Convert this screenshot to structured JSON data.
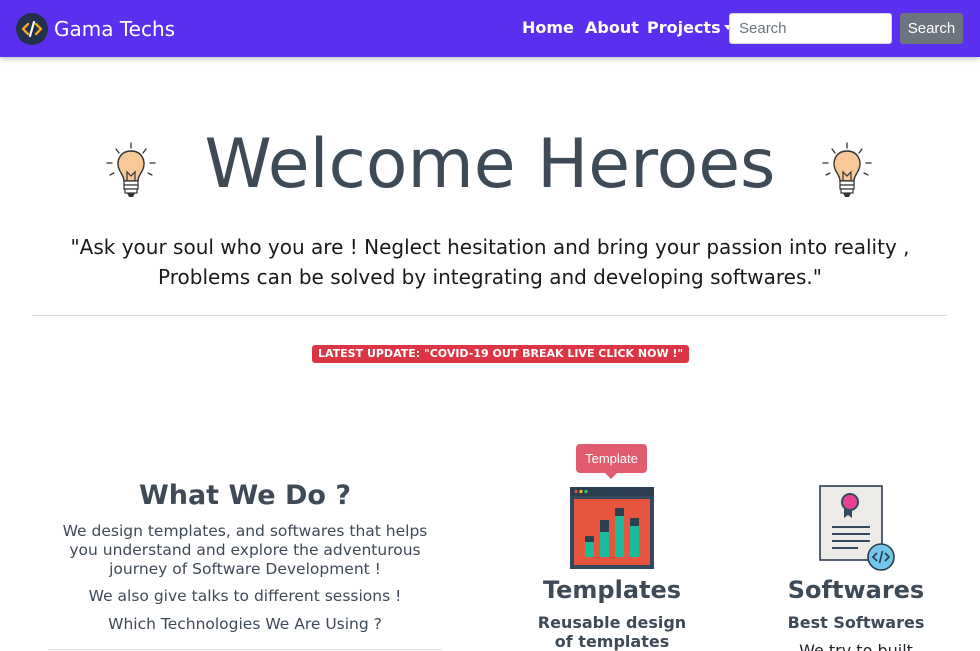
{
  "navbar": {
    "brand": "Gama Techs",
    "brand_icon": "code-icon",
    "links": {
      "home": "Home",
      "about": "About",
      "projects": "Projects"
    },
    "search": {
      "placeholder": "Search",
      "button": "Search"
    },
    "colors": {
      "background": "#5b2ff0",
      "button": "#6c757d"
    }
  },
  "hero": {
    "title": "Welcome Heroes",
    "quote": "\"Ask your soul who you are ! Neglect hesitation and bring your passion into reality , Problems can be solved by integrating and developing softwares.\"",
    "badge": "LATEST UPDATE: \"COVID-19 OUT BREAK LIVE CLICK NOW !\"",
    "badge_color": "#dc3545",
    "icons": [
      "light-bulb-icon",
      "light-bulb-icon"
    ]
  },
  "what_we_do": {
    "title": "What We Do ?",
    "paragraph1": "We design templates, and softwares that helps you understand and explore the adventurous journey of Software Development !",
    "paragraph2": "We also give talks to different sessions !",
    "paragraph3": "Which Technologies We Are Using ?"
  },
  "cards": {
    "templates": {
      "tooltip": "Template",
      "title": "Templates",
      "subtitle": "Reusable design of templates",
      "icon": "bar-chart-window-icon"
    },
    "softwares": {
      "title": "Softwares",
      "subtitle": "Best Softwares",
      "text": "We try to built",
      "icon": "certificate-code-icon"
    }
  }
}
